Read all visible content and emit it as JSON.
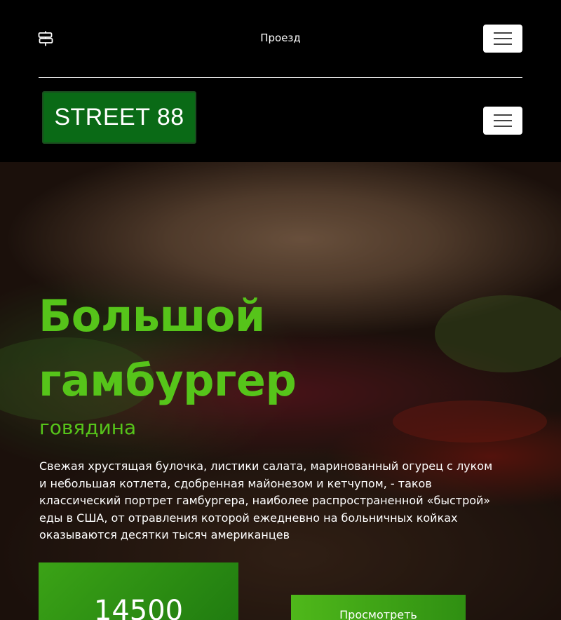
{
  "topbar": {
    "icon": "signpost-icon",
    "link_label": "Проезд"
  },
  "brand": {
    "logo_text": "STREET 88",
    "accent_color": "#0a6a16"
  },
  "hero": {
    "title": "Большой гамбургер",
    "subtitle": "говядина",
    "description": "Свежая хрустящая булочка, листики салата, маринованный огурец с луком и небольшая котлета, сдобренная майонезом и кетчупом, - таков классический портрет гамбургера, наиболее распространенной «быстрой» еды в США, от отравления которой ежедневно на больничных койках оказываются десятки тысяч американцев",
    "price": "14500",
    "button_label": "Просмотреть",
    "title_color": "#56c41a"
  }
}
